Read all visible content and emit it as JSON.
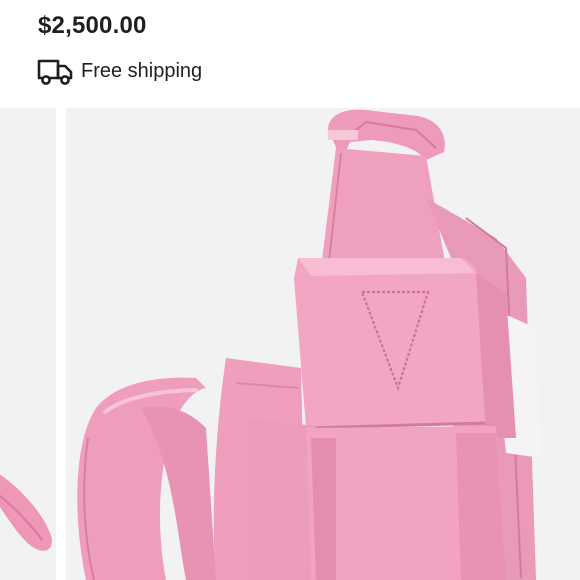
{
  "product": {
    "price": "$2,500.00",
    "shipping_label": "Free shipping",
    "shipping_icon": "truck-icon"
  },
  "gallery": {
    "previous_image": "pink-bag-strap-thumbnail",
    "main_image": "pink-woven-leather-bag-closeup"
  },
  "colors": {
    "text": "#1f1f1f",
    "background": "#f2f2f3",
    "bag_pink": "#ef9ab9"
  }
}
